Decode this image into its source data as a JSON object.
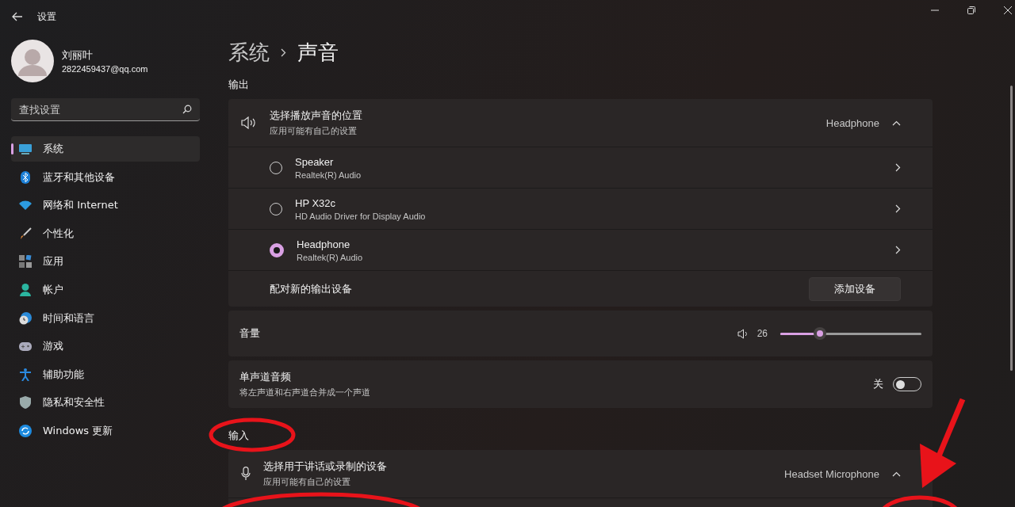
{
  "window": {
    "title": "设置"
  },
  "user": {
    "name": "刘丽叶",
    "email": "2822459437@qq.com"
  },
  "search": {
    "placeholder": "查找设置"
  },
  "nav": [
    {
      "label": "系统",
      "selected": true
    },
    {
      "label": "蓝牙和其他设备",
      "selected": false
    },
    {
      "label": "网络和 Internet",
      "selected": false
    },
    {
      "label": "个性化",
      "selected": false
    },
    {
      "label": "应用",
      "selected": false
    },
    {
      "label": "帐户",
      "selected": false
    },
    {
      "label": "时间和语言",
      "selected": false
    },
    {
      "label": "游戏",
      "selected": false
    },
    {
      "label": "辅助功能",
      "selected": false
    },
    {
      "label": "隐私和安全性",
      "selected": false
    },
    {
      "label": "Windows 更新",
      "selected": false
    }
  ],
  "breadcrumb": [
    "系统",
    "声音"
  ],
  "output": {
    "heading": "输出",
    "title": "选择播放声音的位置",
    "subtitle": "应用可能有自己的设置",
    "value": "Headphone",
    "expanded": true,
    "devices": [
      {
        "name": "Speaker",
        "driver": "Realtek(R) Audio",
        "selected": false
      },
      {
        "name": "HP X32c",
        "driver": "HD Audio Driver for Display Audio",
        "selected": false
      },
      {
        "name": "Headphone",
        "driver": "Realtek(R) Audio",
        "selected": true
      }
    ],
    "pair_label": "配对新的输出设备",
    "pair_button": "添加设备"
  },
  "volume": {
    "label": "音量",
    "reading": "26",
    "level": 0.26
  },
  "mono": {
    "title": "单声道音频",
    "subtitle": "将左声道和右声道合并成一个声道",
    "state_label": "关",
    "on": false
  },
  "input": {
    "heading": "输入",
    "title": "选择用于讲话或录制的设备",
    "subtitle": "应用可能有自己的设置",
    "value": "Headset Microphone",
    "expanded": true
  }
}
